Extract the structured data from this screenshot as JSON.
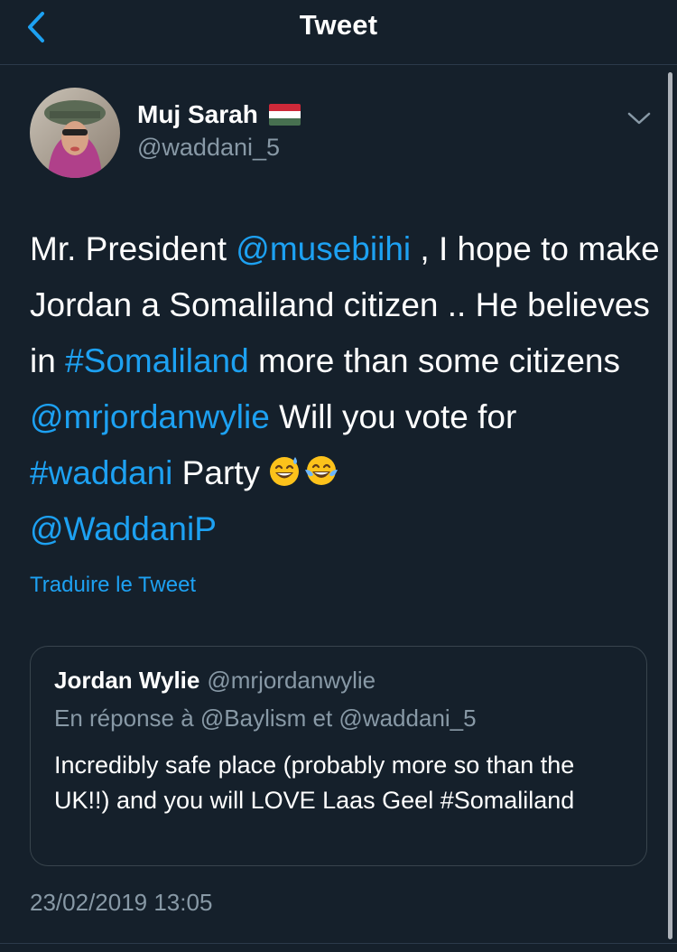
{
  "nav": {
    "title": "Tweet",
    "back_icon": "chevron-left-icon"
  },
  "tweet": {
    "author_name": "Muj Sarah",
    "author_flag": "hungary-flag",
    "handle": "@waddani_5",
    "text_parts": {
      "p1": "Mr. President ",
      "mention1": "@musebiihi",
      "p2": " , I hope to make Jordan a Somaliland citizen .. He believes in ",
      "hashtag1": "#Somaliland",
      "p3": " more than some citizens ",
      "mention2": "@mrjordanwylie",
      "p4": " Will you vote for ",
      "hashtag2": "#waddani",
      "p5": " Party",
      "mention3": "@WaddaniP"
    },
    "emojis": [
      "grinning-sweat-emoji",
      "tears-of-joy-emoji"
    ],
    "translate_label": "Traduire le Tweet",
    "timestamp": "23/02/2019 13:05"
  },
  "quoted_tweet": {
    "author_name": "Jordan Wylie",
    "handle": "@mrjordanwylie",
    "reply_context": "En réponse à @Baylism et @waddani_5",
    "text": "Incredibly safe place (probably more so than the UK!!) and you will LOVE Laas Geel #Somaliland"
  },
  "colors": {
    "background": "#15202b",
    "accent": "#1da1f2",
    "secondary_text": "#8899a6",
    "border": "#38444d"
  }
}
